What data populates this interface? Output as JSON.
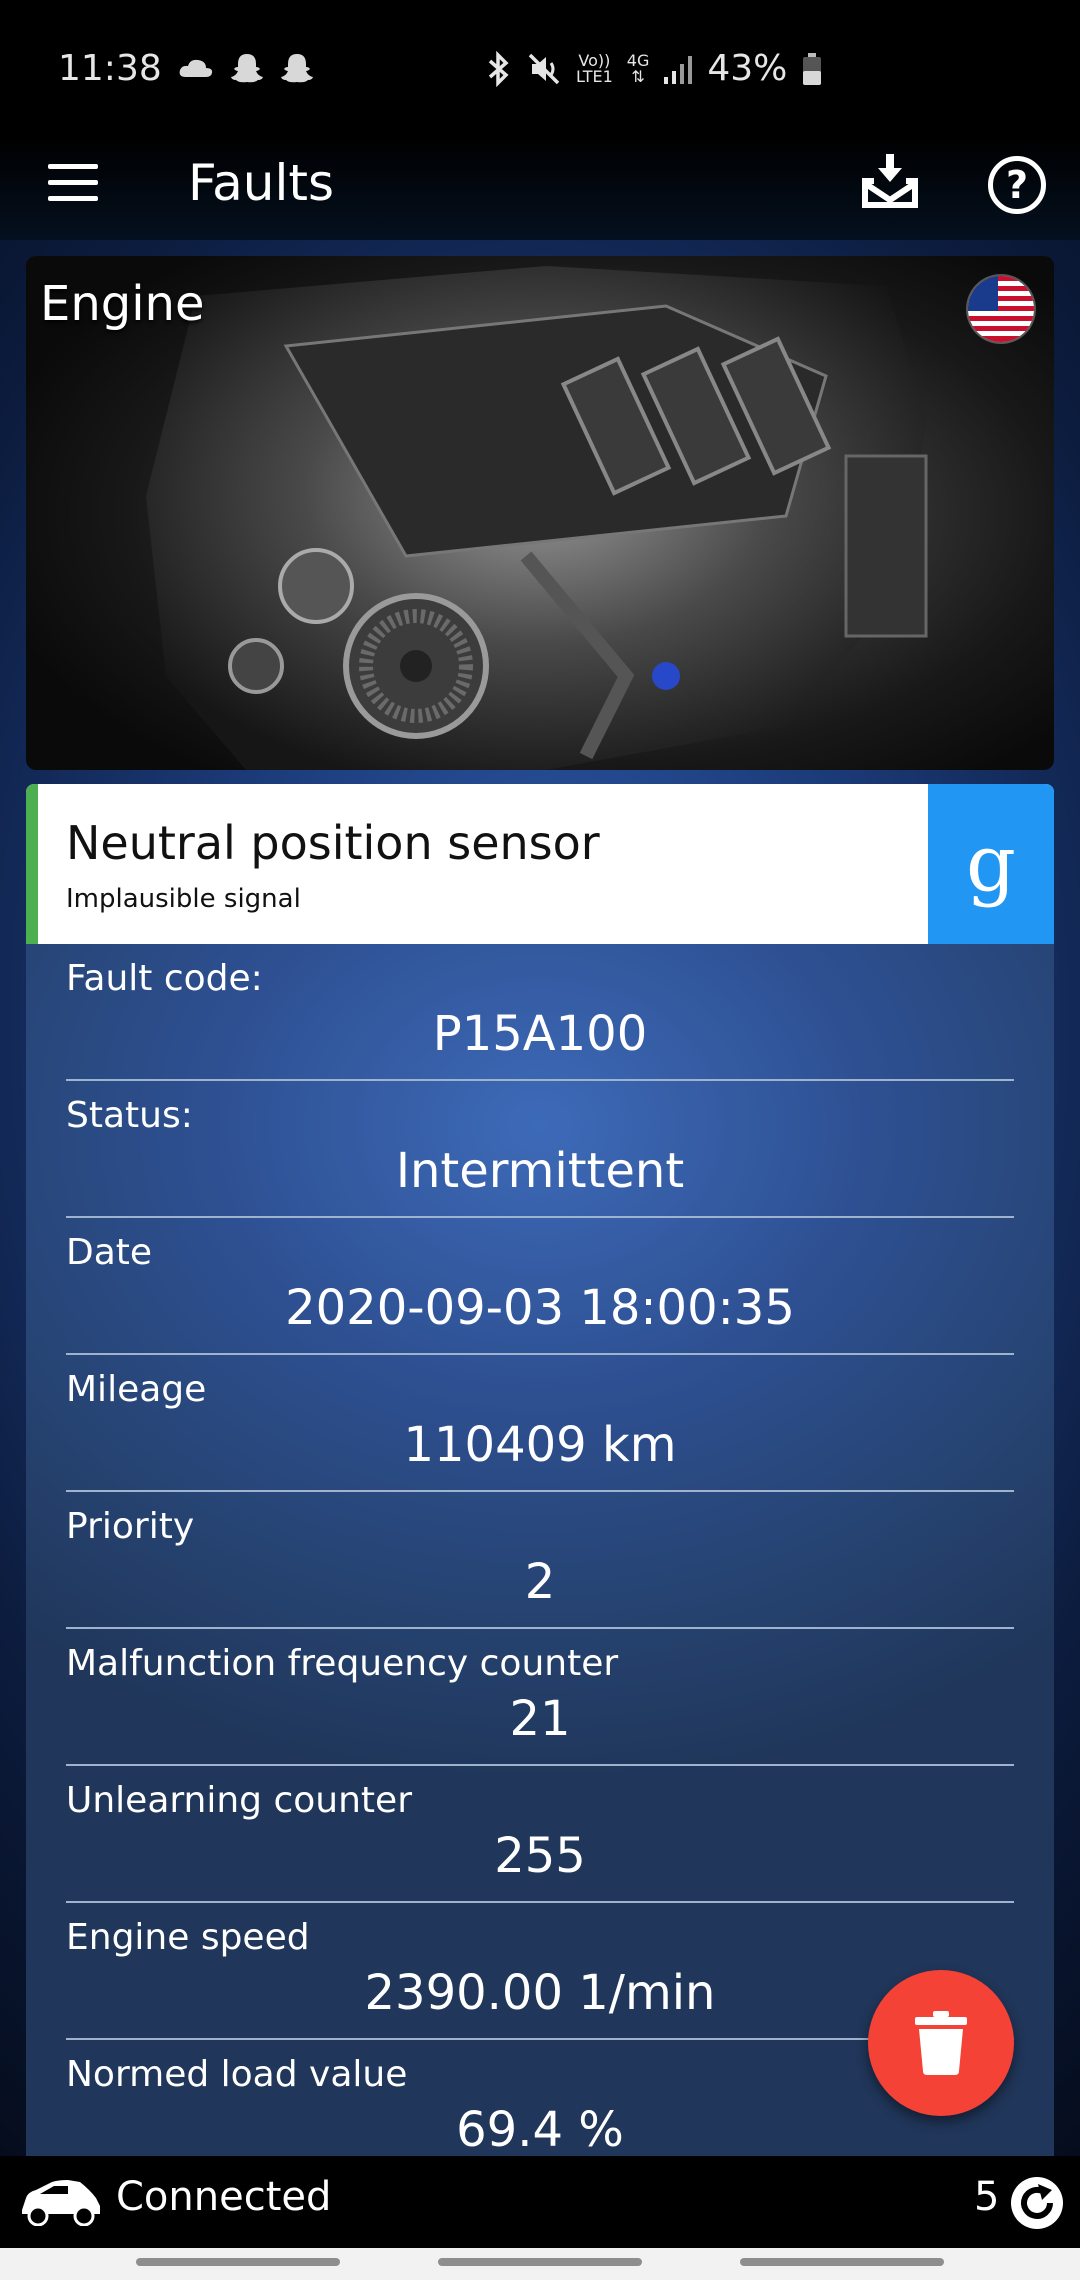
{
  "status_bar": {
    "time": "11:38",
    "volte": "Vo))",
    "lte": "LTE1",
    "network": "4G",
    "battery": "43%"
  },
  "app_bar": {
    "title": "Faults"
  },
  "engine_card": {
    "label": "Engine"
  },
  "fault": {
    "title": "Neutral position sensor",
    "subtitle": "Implausible signal",
    "google_label": "g"
  },
  "details": [
    {
      "label": "Fault code:",
      "value": "P15A100"
    },
    {
      "label": "Status:",
      "value": "Intermittent"
    },
    {
      "label": "Date",
      "value": "2020-09-03 18:00:35"
    },
    {
      "label": "Mileage",
      "value": "110409 km"
    },
    {
      "label": "Priority",
      "value": "2"
    },
    {
      "label": "Malfunction frequency counter",
      "value": "21"
    },
    {
      "label": "Unlearning counter",
      "value": "255"
    },
    {
      "label": "Engine speed",
      "value": "2390.00 1/min"
    },
    {
      "label": "Normed load value",
      "value": "69.4 %"
    }
  ],
  "bottom_bar": {
    "connection_status": "Connected",
    "count": "5"
  },
  "colors": {
    "accent_green": "#4caf50",
    "google_blue": "#2196f3",
    "fab_red": "#f44336"
  }
}
